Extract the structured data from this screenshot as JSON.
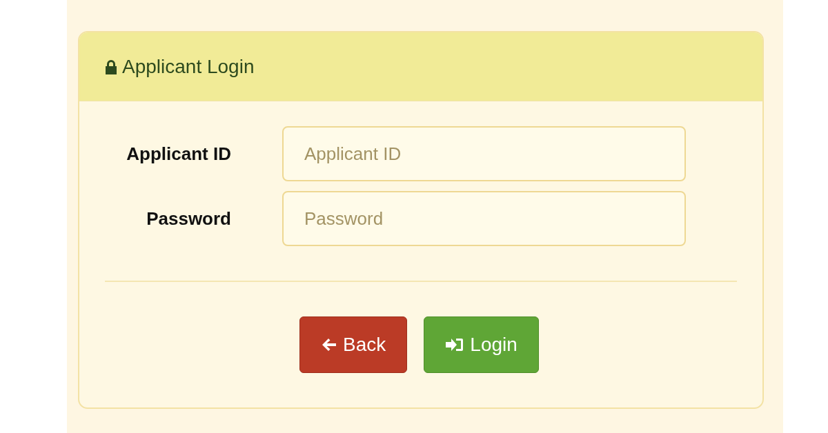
{
  "panel": {
    "title": "Applicant Login"
  },
  "fields": [
    {
      "label": "Applicant ID",
      "placeholder": "Applicant ID"
    },
    {
      "label": "Password",
      "placeholder": "Password"
    }
  ],
  "buttons": [
    {
      "label": "Back",
      "kind": "back"
    },
    {
      "label": "Login",
      "kind": "login"
    }
  ]
}
